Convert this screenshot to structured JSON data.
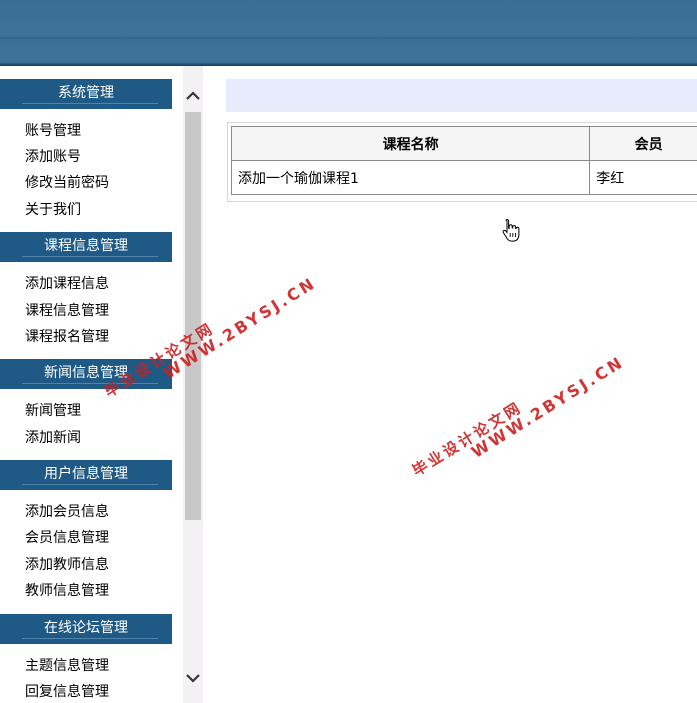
{
  "sidebar": {
    "sections": [
      {
        "title": "系统管理",
        "items": [
          "账号管理",
          "添加账号",
          "修改当前密码",
          "关于我们"
        ]
      },
      {
        "title": "课程信息管理",
        "items": [
          "添加课程信息",
          "课程信息管理",
          "课程报名管理"
        ]
      },
      {
        "title": "新闻信息管理",
        "items": [
          "新闻管理",
          "添加新闻"
        ]
      },
      {
        "title": "用户信息管理",
        "items": [
          "添加会员信息",
          "会员信息管理",
          "添加教师信息",
          "教师信息管理"
        ]
      },
      {
        "title": "在线论坛管理",
        "items": [
          "主题信息管理",
          "回复信息管理"
        ]
      }
    ]
  },
  "table": {
    "headers": [
      "课程名称",
      "会员"
    ],
    "rows": [
      [
        "添加一个瑜伽课程1",
        "李红"
      ]
    ]
  },
  "watermark": {
    "line1": "毕业设计论文网",
    "line2": "WWW.2BYSJ.CN"
  },
  "colors": {
    "banner": "#3d7399",
    "section_header": "#1f5a86",
    "info_bar": "#e7ebfb",
    "watermark": "#cc1f1f"
  },
  "icons": {
    "scroll_up": "chevron-up-icon",
    "scroll_down": "chevron-down-icon",
    "cursor": "hand-pointer-icon"
  }
}
